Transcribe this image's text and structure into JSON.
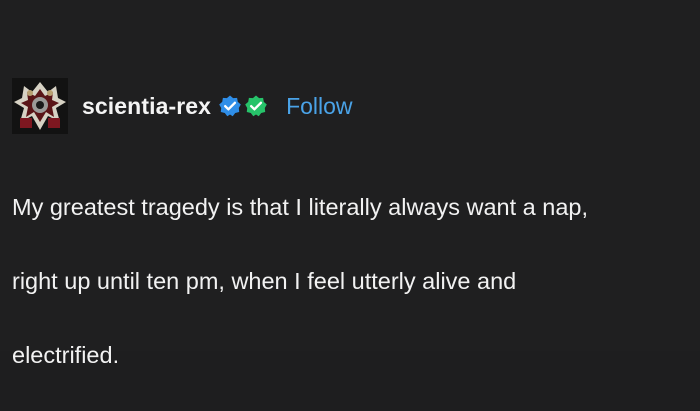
{
  "post": {
    "author": {
      "username": "scientia-rex",
      "avatar_icon": "avatar-image",
      "badges": [
        {
          "name": "blue-verified-badge-icon",
          "color": "#2f8ee8"
        },
        {
          "name": "green-verified-badge-icon",
          "color": "#27c36a"
        }
      ]
    },
    "follow_label": "Follow",
    "body_lines": [
      "My greatest tragedy is that I literally always want a nap,",
      "right up until ten pm, when I feel utterly alive and",
      "electrified."
    ]
  },
  "colors": {
    "background": "#1f1f20",
    "text": "#f2f2f2",
    "follow": "#4aa3e8"
  }
}
